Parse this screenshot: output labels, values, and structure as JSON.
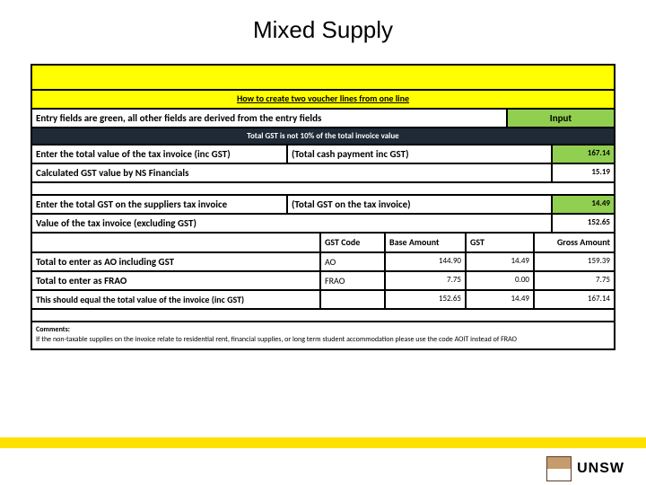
{
  "title": "Mixed Supply",
  "instruction": "How to create two voucher lines from one line",
  "note_left": "Entry fields are green, all other fields are derived from the entry fields",
  "note_right": "Input",
  "banner": "Total GST is not 10% of the total invoice value",
  "rows": {
    "r1": {
      "label": "Enter the total value of the tax invoice (inc GST)",
      "mid": "(Total cash payment inc GST)",
      "val": "167.14"
    },
    "r2": {
      "label": "Calculated GST value by NS Financials",
      "mid": "",
      "val": "15.19"
    },
    "r3": {
      "label": "Enter the total GST on the suppliers tax invoice",
      "mid": "(Total GST on the tax invoice)",
      "val": "14.49"
    },
    "r4": {
      "label": "Value of the tax invoice (excluding GST)",
      "mid": "",
      "val": "152.65"
    }
  },
  "headers": {
    "code": "GST Code",
    "base": "Base Amount",
    "gst": "GST",
    "gross": "Gross Amount"
  },
  "data": {
    "d1": {
      "desc": "Total to enter as AO including GST",
      "code": "AO",
      "base": "144.90",
      "gst": "14.49",
      "gross": "159.39"
    },
    "d2": {
      "desc": "Total to enter as FRAO",
      "code": "FRAO",
      "base": "7.75",
      "gst": "0.00",
      "gross": "7.75"
    },
    "tot": {
      "desc": "This should equal the total value of the invoice (inc GST)",
      "code": "",
      "base": "152.65",
      "gst": "14.49",
      "gross": "167.14"
    }
  },
  "comments": {
    "title": "Comments:",
    "body": "If the non-taxable supplies on the invoice relate to residential rent, financial supplies, or long term student accommodation please use the code AOIT instead of FRAO"
  },
  "logo": "UNSW"
}
